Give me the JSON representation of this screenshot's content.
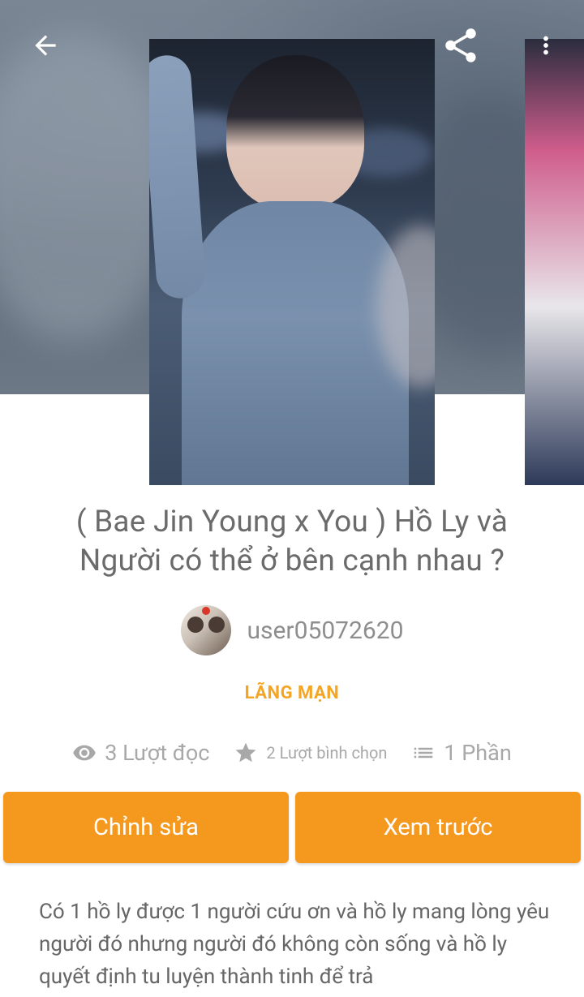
{
  "header": {
    "back_icon": "arrow-left-icon",
    "share_icon": "share-icon",
    "more_icon": "more-vertical-icon"
  },
  "story": {
    "title": "( Bae Jin  Young  x You ) Hồ Ly và\nNgười có thể ở bên cạnh nhau ?",
    "author": "user05072620",
    "genre": "LÃNG MẠN",
    "stats": {
      "reads": "3 Lượt đọc",
      "votes": "2 Lượt bình chọn",
      "parts": "1 Phần"
    },
    "description": "Có 1 hồ ly được 1 người cứu ơn và hồ  ly mang lòng  yêu người đó nhưng  người đó không còn sống và hồ ly quyết định tu luyện thành  tinh để trả"
  },
  "actions": {
    "edit_label": "Chỉnh sửa",
    "preview_label": "Xem trước"
  },
  "colors": {
    "accent": "#f5981e",
    "genre": "#f5a524",
    "text": "#6b6b6b"
  }
}
